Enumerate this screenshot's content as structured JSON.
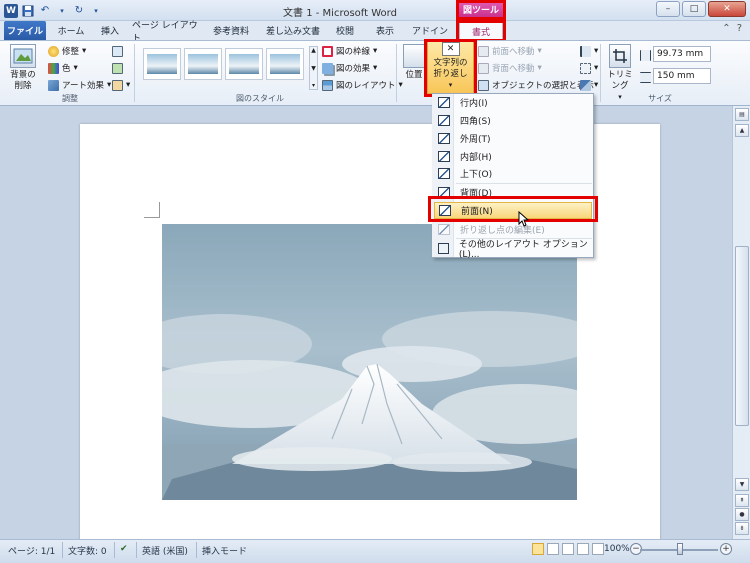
{
  "titlebar": {
    "title": "文書 1 - Microsoft Word",
    "qat": {
      "word_icon": "W",
      "undo_icon": "↶",
      "redo_icon": "↻",
      "customize_icon": "▾"
    },
    "controls": {
      "minimize": "–",
      "maximize": "□",
      "close": "✕"
    }
  },
  "context_tab": {
    "label": "図ツール"
  },
  "tabs": [
    "ファイル",
    "ホーム",
    "挿入",
    "ページ レイアウト",
    "参考資料",
    "差し込み文書",
    "校閲",
    "表示",
    "アドイン",
    "書式"
  ],
  "ribbon": {
    "adjust": {
      "remove_bg": "背景の\n削除",
      "corrections": "修整",
      "color": "色",
      "artistic": "アート効果",
      "label": "調整"
    },
    "picture_styles": {
      "border": "図の枠線",
      "effects": "図の効果",
      "layout": "図のレイアウト",
      "label": "図のスタイル"
    },
    "arrange": {
      "position": "位置",
      "wrap_text": "文字列の\n折り返し",
      "bring_forward": "前面へ移動",
      "send_backward": "背面へ移動",
      "selection_pane": "オブジェクトの選択と表示"
    },
    "size": {
      "crop": "トリミング",
      "height": "99.73 mm",
      "width": "150 mm",
      "label": "サイズ"
    }
  },
  "wrap_menu": [
    {
      "label": "行内(I)",
      "disabled": false
    },
    {
      "label": "四角(S)",
      "disabled": false
    },
    {
      "label": "外周(T)",
      "disabled": false
    },
    {
      "label": "内部(H)",
      "disabled": false
    },
    {
      "label": "上下(O)",
      "disabled": false
    },
    {
      "label": "背面(D)",
      "disabled": false
    },
    {
      "label": "前面(N)",
      "disabled": false,
      "highlighted": true
    },
    {
      "label": "折り返し点の編集(E)",
      "disabled": true
    },
    {
      "label": "その他のレイアウト オプション(L)...",
      "disabled": false
    }
  ],
  "statusbar": {
    "page": "ページ: 1/1",
    "words": "文字数: 0",
    "language": "英語 (米国)",
    "mode": "挿入モード",
    "zoom": "100%",
    "zoom_fraction": 0.5
  },
  "colors": {
    "accent_red": "#e50000",
    "context_pink": "#c9318f",
    "file_tab_blue": "#2a5aa6",
    "highlight_yellow": "#f8d67b"
  }
}
